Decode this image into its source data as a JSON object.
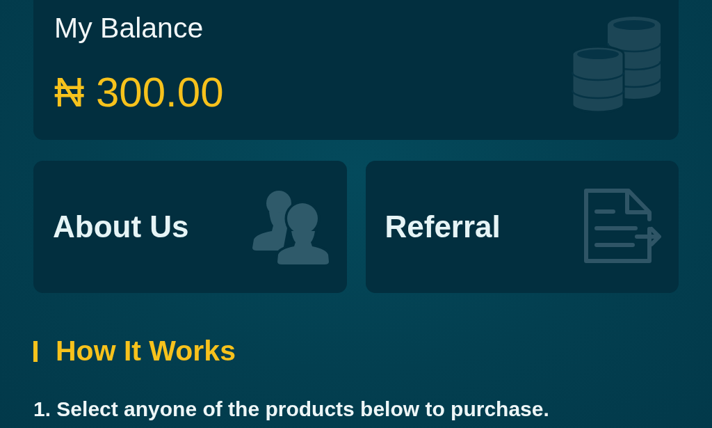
{
  "balance_card": {
    "title": "My Balance",
    "amount": "₦ 300.00"
  },
  "tiles": [
    {
      "label": "About Us",
      "kind": "people"
    },
    {
      "label": "Referral",
      "kind": "document"
    }
  ],
  "how_it_works": {
    "title": "How It Works",
    "steps": [
      "1. Select anyone of the products below to purchase."
    ]
  }
}
